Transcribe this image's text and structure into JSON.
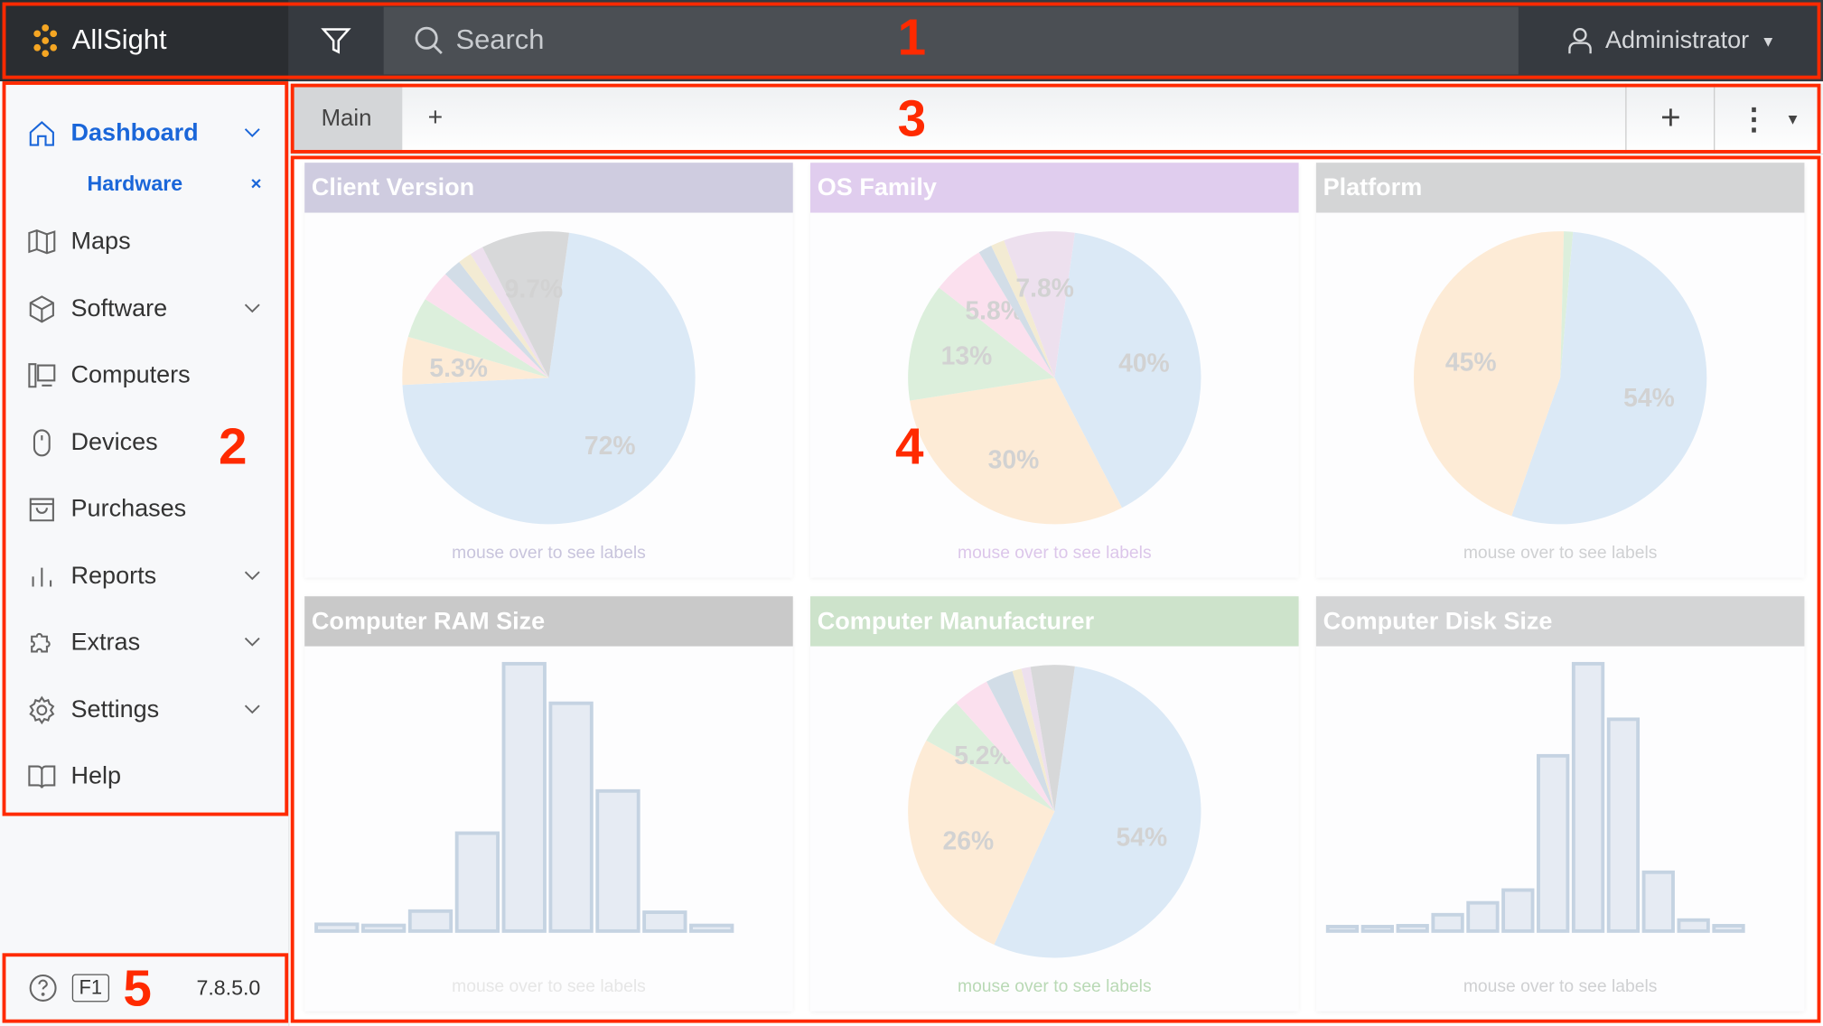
{
  "app": {
    "name": "AllSight",
    "accent": "#f5a623"
  },
  "topbar": {
    "search_placeholder": "Search",
    "user": "Administrator",
    "filter_icon": "filter-icon"
  },
  "sidebar": {
    "items": [
      {
        "label": "Dashboard",
        "icon": "home-icon",
        "chevron": true,
        "active": true
      },
      {
        "label": "Maps",
        "icon": "map-icon",
        "chevron": false
      },
      {
        "label": "Software",
        "icon": "box-icon",
        "chevron": true
      },
      {
        "label": "Computers",
        "icon": "computer-icon",
        "chevron": false
      },
      {
        "label": "Devices",
        "icon": "mouse-icon",
        "chevron": false
      },
      {
        "label": "Purchases",
        "icon": "bag-icon",
        "chevron": false
      },
      {
        "label": "Reports",
        "icon": "bar-chart-icon",
        "chevron": true
      },
      {
        "label": "Extras",
        "icon": "puzzle-icon",
        "chevron": true
      },
      {
        "label": "Settings",
        "icon": "gear-icon",
        "chevron": true
      },
      {
        "label": "Help",
        "icon": "book-icon",
        "chevron": false
      }
    ],
    "subitem": {
      "label": "Hardware",
      "close": "×"
    },
    "footer": {
      "help_key": "F1",
      "version": "7.8.5.0"
    }
  },
  "tabs": {
    "items": [
      "Main"
    ],
    "add": "+",
    "toolbar_add": "+"
  },
  "hint": "mouse over to see labels",
  "colors": {
    "blue": "#dbe9f6",
    "orange": "#fdebd6",
    "green": "#dcefdc",
    "pink": "#fbe0ee",
    "slate": "#d2dde7",
    "yellow": "#f3ebd3",
    "lavender": "#ede0ee",
    "gray": "#d7d8d9",
    "bar_fill": "#e6ebf3",
    "bar_stroke": "#c5d3e2"
  },
  "annotations": [
    "1",
    "2",
    "3",
    "4",
    "5"
  ],
  "chart_data": [
    {
      "type": "pie",
      "title": "Client Version",
      "header_color": "#cfcce0",
      "hint_color": "#c8c4dc",
      "start_angle": 8,
      "slices": [
        {
          "value": 72,
          "label": "72%",
          "color": "blue"
        },
        {
          "value": 5.3,
          "label": "5.3%",
          "color": "orange"
        },
        {
          "value": 4.5,
          "label": "",
          "color": "green"
        },
        {
          "value": 3.5,
          "label": "",
          "color": "pink"
        },
        {
          "value": 2,
          "label": "",
          "color": "slate"
        },
        {
          "value": 1.5,
          "label": "",
          "color": "yellow"
        },
        {
          "value": 1.5,
          "label": "",
          "color": "lavender"
        },
        {
          "value": 9.7,
          "label": "9.7%",
          "color": "gray"
        }
      ]
    },
    {
      "type": "pie",
      "title": "OS Family",
      "header_color": "#e0cdee",
      "hint_color": "#dcc6ea",
      "start_angle": 8,
      "slices": [
        {
          "value": 40,
          "label": "40%",
          "color": "blue"
        },
        {
          "value": 30,
          "label": "30%",
          "color": "orange"
        },
        {
          "value": 13,
          "label": "13%",
          "color": "green"
        },
        {
          "value": 5.8,
          "label": "5.8%",
          "color": "pink"
        },
        {
          "value": 1.5,
          "label": "",
          "color": "slate"
        },
        {
          "value": 1.5,
          "label": "",
          "color": "yellow"
        },
        {
          "value": 7.8,
          "label": "7.8%",
          "color": "lavender"
        }
      ]
    },
    {
      "type": "pie",
      "title": "Platform",
      "header_color": "#d4d5d6",
      "hint_color": "#cfd0d2",
      "start_angle": 5,
      "slices": [
        {
          "value": 54,
          "label": "54%",
          "color": "blue"
        },
        {
          "value": 45,
          "label": "45%",
          "color": "orange"
        },
        {
          "value": 1,
          "label": "",
          "color": "green"
        }
      ]
    },
    {
      "type": "bar",
      "title": "Computer RAM Size",
      "header_color": "#c9c9c9",
      "hint_color": "#e6e6e6",
      "values": [
        18,
        15,
        53,
        260,
        710,
        605,
        372,
        50,
        15
      ]
    },
    {
      "type": "pie",
      "title": "Computer Manufacturer",
      "header_color": "#cde3cb",
      "hint_color": "#b9d9b5",
      "start_angle": 8,
      "slices": [
        {
          "value": 54,
          "label": "54%",
          "color": "blue"
        },
        {
          "value": 26,
          "label": "26%",
          "color": "orange"
        },
        {
          "value": 5.2,
          "label": "5.2%",
          "color": "green"
        },
        {
          "value": 4,
          "label": "",
          "color": "pink"
        },
        {
          "value": 3,
          "label": "",
          "color": "slate"
        },
        {
          "value": 1,
          "label": "",
          "color": "yellow"
        },
        {
          "value": 1,
          "label": "",
          "color": "lavender"
        },
        {
          "value": 4.8,
          "label": "",
          "color": "gray"
        }
      ]
    },
    {
      "type": "bar",
      "title": "Computer Disk Size",
      "header_color": "#d4d5d6",
      "hint_color": "#cfd0d2",
      "values": [
        15,
        15,
        18,
        55,
        95,
        138,
        590,
        900,
        713,
        198,
        37,
        18
      ]
    }
  ]
}
